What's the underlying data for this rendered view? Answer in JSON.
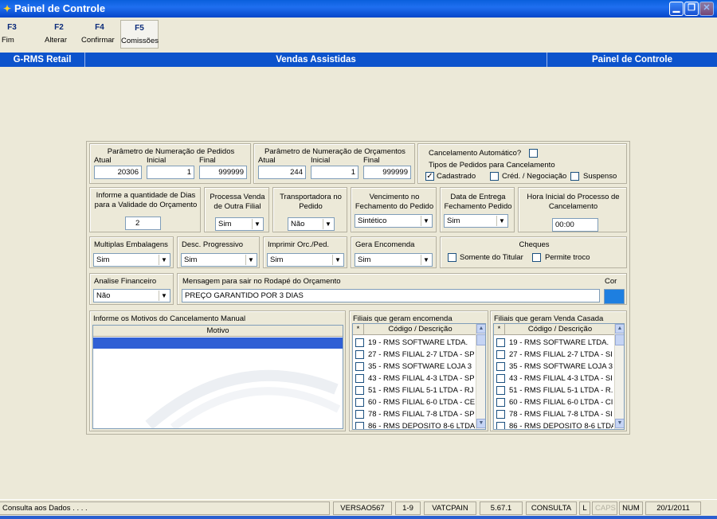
{
  "window": {
    "title": "Painel de Controle"
  },
  "toolbar": [
    {
      "key": "F3",
      "label": "Fim"
    },
    {
      "key": "F2",
      "label": "Alterar"
    },
    {
      "key": "F4",
      "label": "Confirmar"
    },
    {
      "key": "F5",
      "label": "Comissões"
    }
  ],
  "header": {
    "left": "G-RMS Retail",
    "center": "Vendas Assistidas",
    "right": "Painel de Controle"
  },
  "pedidos": {
    "title": "Parâmetro de Numeração de Pedidos",
    "atual_label": "Atual",
    "inicial_label": "Inicial",
    "final_label": "Final",
    "atual": "20306",
    "inicial": "1",
    "final": "999999"
  },
  "orcamentos": {
    "title": "Parâmetro de Numeração de Orçamentos",
    "atual_label": "Atual",
    "inicial_label": "Inicial",
    "final_label": "Final",
    "atual": "244",
    "inicial": "1",
    "final": "999999"
  },
  "cancelamento": {
    "auto_label": "Cancelamento Automático?",
    "tipos_label": "Tipos de Pedidos para Cancelamento",
    "opt1": "Cadastrado",
    "opt2": "Créd. / Negociação",
    "opt3": "Suspenso",
    "auto_checked": false,
    "opt1_checked": true,
    "opt2_checked": false,
    "opt3_checked": false
  },
  "validade": {
    "label1": "Informe a quantidade de Dias",
    "label2": "para a Validade do Orçamento",
    "value": "2"
  },
  "processa": {
    "label1": "Processa Venda",
    "label2": "de Outra Filial",
    "value": "Sim"
  },
  "transportadora": {
    "label1": "Transportadora no",
    "label2": "Pedido",
    "value": "Não"
  },
  "vencimento": {
    "label1": "Vencimento no",
    "label2": "Fechamento do Pedido",
    "value": "Sintético"
  },
  "entrega": {
    "label1": "Data de Entrega",
    "label2": "Fechamento Pedido",
    "value": "Sim"
  },
  "hora": {
    "label1": "Hora Inicial do Processo de",
    "label2": "Cancelamento",
    "value": "00:00"
  },
  "embalagens": {
    "label": "Multiplas Embalagens",
    "value": "Sim"
  },
  "desconto": {
    "label": "Desc. Progressivo",
    "value": "Sim"
  },
  "imprimir": {
    "label": "Imprimir Orc./Ped.",
    "value": "Sim"
  },
  "encomenda": {
    "label": "Gera Encomenda",
    "value": "Sim"
  },
  "cheques": {
    "title": "Cheques",
    "opt1": "Somente do Titular",
    "opt2": "Permite troco"
  },
  "financeiro": {
    "label": "Analise Financeiro",
    "value": "Não"
  },
  "mensagem": {
    "label": "Mensagem para sair no Rodapé do Orçamento",
    "value": "PREÇO GARANTIDO POR 3 DIAS"
  },
  "cor": {
    "label": "Cor",
    "color": "#1e7fe0"
  },
  "motivos": {
    "title": "Informe os Motivos do Cancelamento Manual",
    "column": "Motivo"
  },
  "filiais_encomenda": {
    "title": "Filiais que geram encomenda",
    "col_star": "*",
    "column": "Código / Descrição",
    "rows": [
      "19 - RMS SOFTWARE LTDA.",
      "27 - RMS FILIAL 2-7 LTDA - SP",
      "35 - RMS SOFTWARE LOJA 3",
      "43 - RMS FILIAL 4-3 LTDA - SP",
      "51 - RMS FILIAL 5-1 LTDA - RJ",
      "60 - RMS FILIAL 6-0 LTDA - CE",
      "78 - RMS FILIAL 7-8 LTDA - SP",
      "86 - RMS DEPOSITO 8-6 LTDA"
    ]
  },
  "filiais_casada": {
    "title": "Filiais que geram Venda Casada",
    "col_star": "*",
    "column": "Código / Descrição",
    "rows": [
      "19 - RMS SOFTWARE LTDA.",
      "27 - RMS FILIAL 2-7 LTDA - SI",
      "35 - RMS SOFTWARE LOJA 3",
      "43 - RMS FILIAL 4-3 LTDA - SI",
      "51 - RMS FILIAL 5-1 LTDA - R.",
      "60 - RMS FILIAL 6-0 LTDA - CI",
      "78 - RMS FILIAL 7-8 LTDA - SI",
      "86 - RMS DEPOSITO 8-6 LTDA"
    ]
  },
  "status": {
    "message": "Consulta aos Dados . . . .",
    "versao": "VERSAO567",
    "range": "1-9",
    "user": "VATCPAIN",
    "build": "5.67.1",
    "mode": "CONSULTA",
    "l": "L",
    "caps": "CAPS",
    "num": "NUM",
    "date": "20/1/2011"
  }
}
